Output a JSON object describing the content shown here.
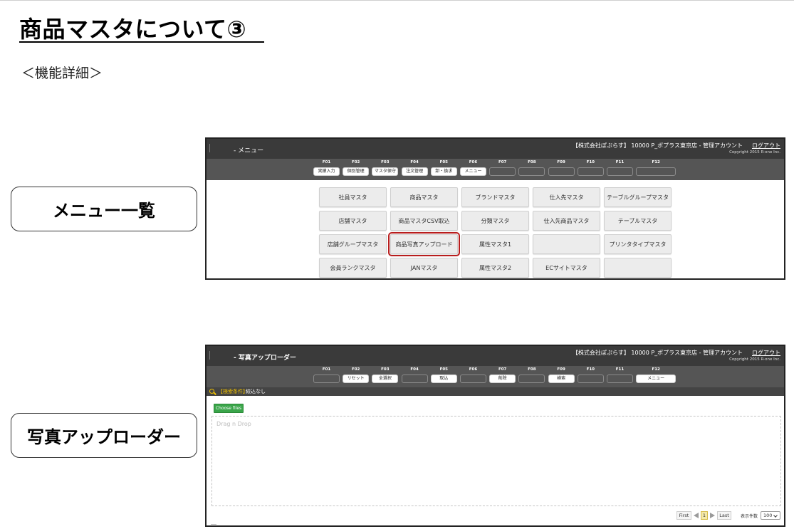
{
  "slide": {
    "title": "商品マスタについて③",
    "subtitle": "＜機能詳細＞",
    "callouts": {
      "menu_list": "メニュー一覧",
      "photo_uploader": "写真アップローダー"
    }
  },
  "menu_screen": {
    "title": "- メニュー",
    "account": "【株式会社ぽぷらす】 10000 P_ポプラス東京店 - 管理アカウント",
    "logout": "ログアウト",
    "copyright": "Copyright 2015 R-one Inc.",
    "fkeys": [
      {
        "key": "F01",
        "label": "実績入力"
      },
      {
        "key": "F02",
        "label": "個別管理"
      },
      {
        "key": "F03",
        "label": "マスタ保守"
      },
      {
        "key": "F04",
        "label": "注文管理"
      },
      {
        "key": "F05",
        "label": "卸・換求"
      },
      {
        "key": "F06",
        "label": "メニュー"
      },
      {
        "key": "F07",
        "label": ""
      },
      {
        "key": "F08",
        "label": ""
      },
      {
        "key": "F09",
        "label": ""
      },
      {
        "key": "F10",
        "label": ""
      },
      {
        "key": "F11",
        "label": ""
      },
      {
        "key": "F12",
        "label": ""
      }
    ],
    "tiles": [
      [
        "社員マスタ",
        "商品マスタ",
        "ブランドマスタ",
        "仕入先マスタ",
        "テーブルグループマスタ"
      ],
      [
        "店舗マスタ",
        "商品マスタCSV取込",
        "分類マスタ",
        "仕入先商品マスタ",
        "テーブルマスタ"
      ],
      [
        "店舗グループマスタ",
        "商品写真アップロード",
        "属性マスタ1",
        "",
        "プリンタタイプマスタ"
      ],
      [
        "会員ランクマスタ",
        "JANマスタ",
        "属性マスタ2",
        "ECサイトマスタ",
        ""
      ]
    ],
    "highlighted_tile": "商品写真アップロード"
  },
  "uploader_screen": {
    "title": "- 写真アップローダー",
    "account": "【株式会社ぽぷらす】 10000 P_ポプラス東京店 - 管理アカウント",
    "logout": "ログアウト",
    "copyright": "Copyright 2015 R-one Inc.",
    "fkeys": [
      {
        "key": "F01",
        "label": ""
      },
      {
        "key": "F02",
        "label": "リセット"
      },
      {
        "key": "F03",
        "label": "全選択"
      },
      {
        "key": "F04",
        "label": ""
      },
      {
        "key": "F05",
        "label": "取込"
      },
      {
        "key": "F06",
        "label": ""
      },
      {
        "key": "F07",
        "label": "削除"
      },
      {
        "key": "F08",
        "label": ""
      },
      {
        "key": "F09",
        "label": "検索"
      },
      {
        "key": "F10",
        "label": ""
      },
      {
        "key": "F11",
        "label": ""
      },
      {
        "key": "F12",
        "label": "メニュー"
      }
    ],
    "search_label": "【検索条件】",
    "search_value": "絞込なし",
    "choose_files": "Choose files",
    "drop_placeholder": "Drag n Drop",
    "pager": {
      "first": "First",
      "current_page": "1",
      "last": "Last",
      "per_page_label": "表示件数",
      "per_page_value": "100"
    }
  },
  "colors": {
    "appbar": "#3a3a3a",
    "fkeybar": "#555555",
    "choose_button": "#3aa54a",
    "highlight_border": "#b81d1d",
    "search_label": "#f2c200"
  }
}
